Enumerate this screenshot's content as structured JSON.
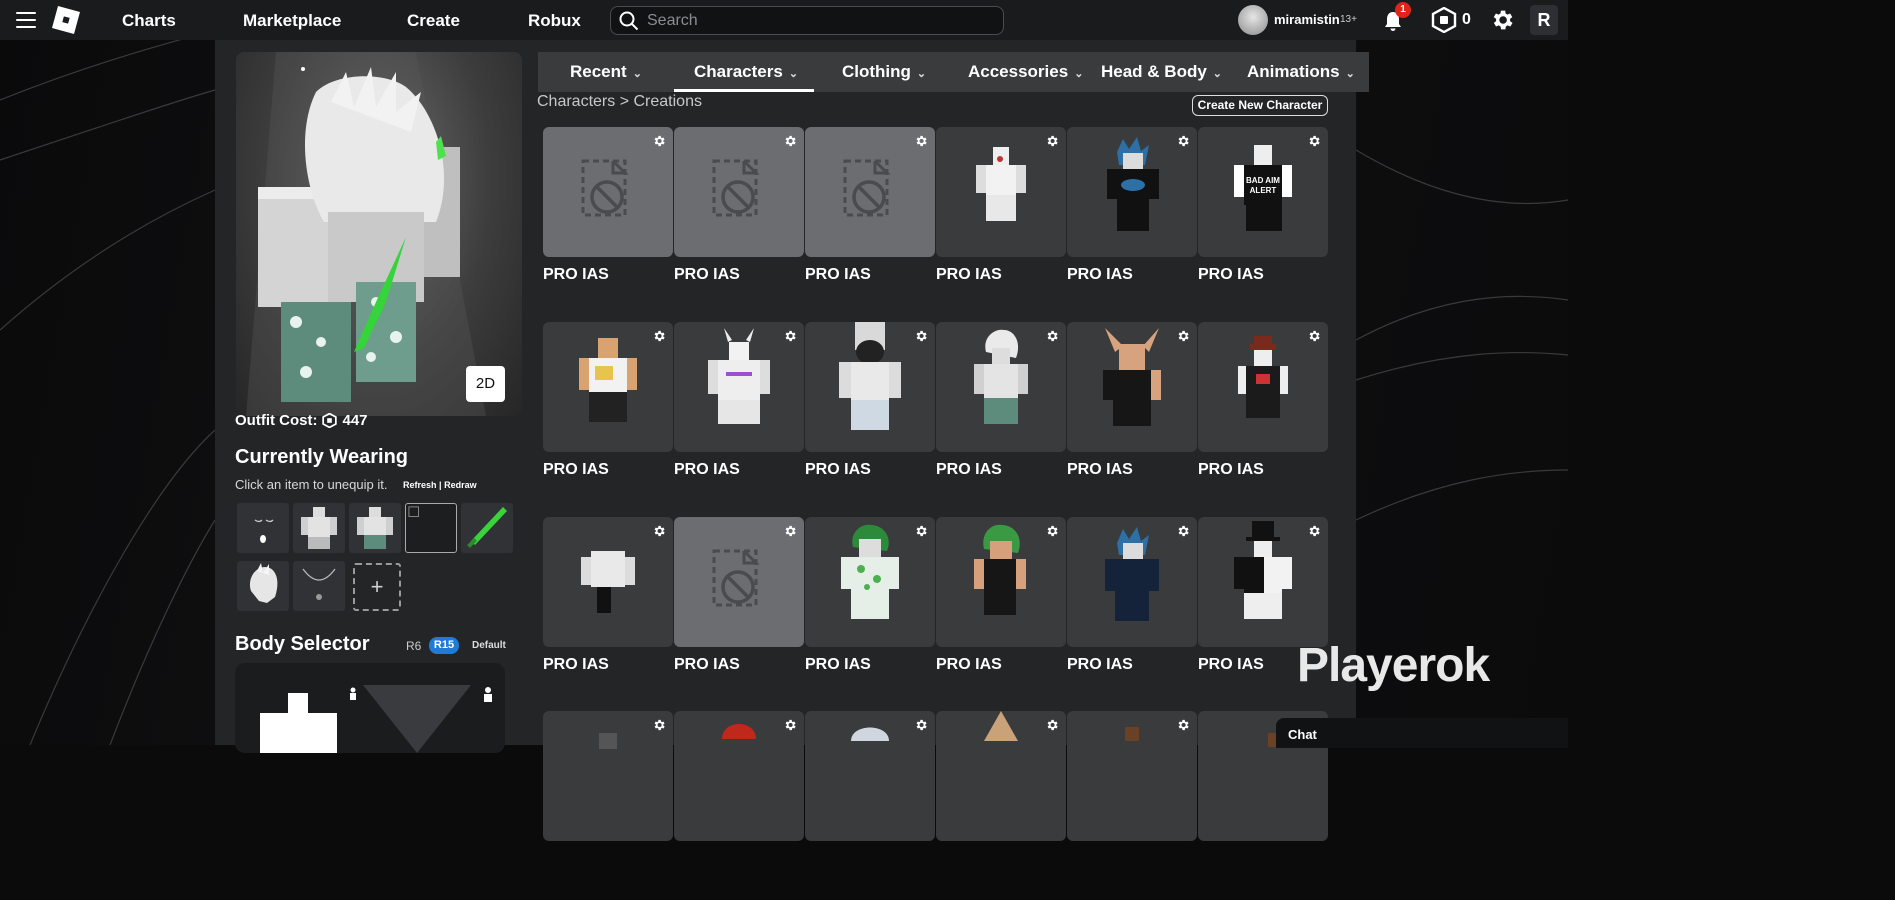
{
  "nav": {
    "links": [
      "Charts",
      "Marketplace",
      "Create",
      "Robux"
    ],
    "search_placeholder": "Search",
    "username": "miramistin",
    "age_badge": "13+",
    "notification_count": "1",
    "robux_balance": "0",
    "extension_label": "R"
  },
  "avatar_panel": {
    "view_toggle": "2D",
    "outfit_cost_label": "Outfit Cost:",
    "outfit_cost_value": "447",
    "currently_wearing_title": "Currently Wearing",
    "currently_wearing_hint": "Click an item to unequip it.",
    "refresh_label": "Refresh",
    "separator": "|",
    "redraw_label": "Redraw",
    "add_label": "+",
    "body_selector_title": "Body Selector",
    "rig_options": [
      "R6",
      "R15"
    ],
    "selected_rig": "R15",
    "default_label": "Default"
  },
  "tabs": [
    {
      "label": "Recent"
    },
    {
      "label": "Characters"
    },
    {
      "label": "Clothing"
    },
    {
      "label": "Accessories"
    },
    {
      "label": "Head & Body"
    },
    {
      "label": "Animations"
    }
  ],
  "active_tab": "Characters",
  "breadcrumb": {
    "root": "Characters",
    "separator": ">",
    "current": "Creations"
  },
  "create_button": "Create New Character",
  "characters": [
    {
      "name": "PRO IAS",
      "thumb": "placeholder"
    },
    {
      "name": "PRO IAS",
      "thumb": "placeholder"
    },
    {
      "name": "PRO IAS",
      "thumb": "placeholder"
    },
    {
      "name": "PRO IAS",
      "thumb": "white-avatar"
    },
    {
      "name": "PRO IAS",
      "thumb": "blue-hair-avatar"
    },
    {
      "name": "PRO IAS",
      "thumb": "bad-aim-avatar"
    },
    {
      "name": "PRO IAS",
      "thumb": "yellow-shirt-avatar"
    },
    {
      "name": "PRO IAS",
      "thumb": "horned-white-avatar"
    },
    {
      "name": "PRO IAS",
      "thumb": "crowned-white-avatar"
    },
    {
      "name": "PRO IAS",
      "thumb": "white-hair-avatar"
    },
    {
      "name": "PRO IAS",
      "thumb": "bunny-ears-avatar"
    },
    {
      "name": "PRO IAS",
      "thumb": "red-hat-avatar"
    },
    {
      "name": "PRO IAS",
      "thumb": "torso-avatar"
    },
    {
      "name": "PRO IAS",
      "thumb": "placeholder"
    },
    {
      "name": "PRO IAS",
      "thumb": "green-hair-pattern-avatar"
    },
    {
      "name": "PRO IAS",
      "thumb": "green-hair-dress-avatar"
    },
    {
      "name": "PRO IAS",
      "thumb": "blue-hair-avatar-2"
    },
    {
      "name": "PRO IAS",
      "thumb": "top-hat-avatar"
    },
    {
      "name": "",
      "thumb": "gray-avatar"
    },
    {
      "name": "",
      "thumb": "red-hair-avatar"
    },
    {
      "name": "",
      "thumb": "white-cap-avatar"
    },
    {
      "name": "",
      "thumb": "cone-avatar"
    },
    {
      "name": "",
      "thumb": "brown-avatar"
    },
    {
      "name": "",
      "thumb": "brown-avatar-2"
    }
  ],
  "watermark": "Playerok",
  "chat_label": "Chat",
  "colors": {
    "topbar": "#191b1d",
    "panel": "#232527",
    "tab_bar": "#393b3d",
    "card": "#393b3d",
    "placeholder_card": "#6c6d70",
    "r15_accent": "#1f7bd8",
    "notification": "#e2231a"
  }
}
